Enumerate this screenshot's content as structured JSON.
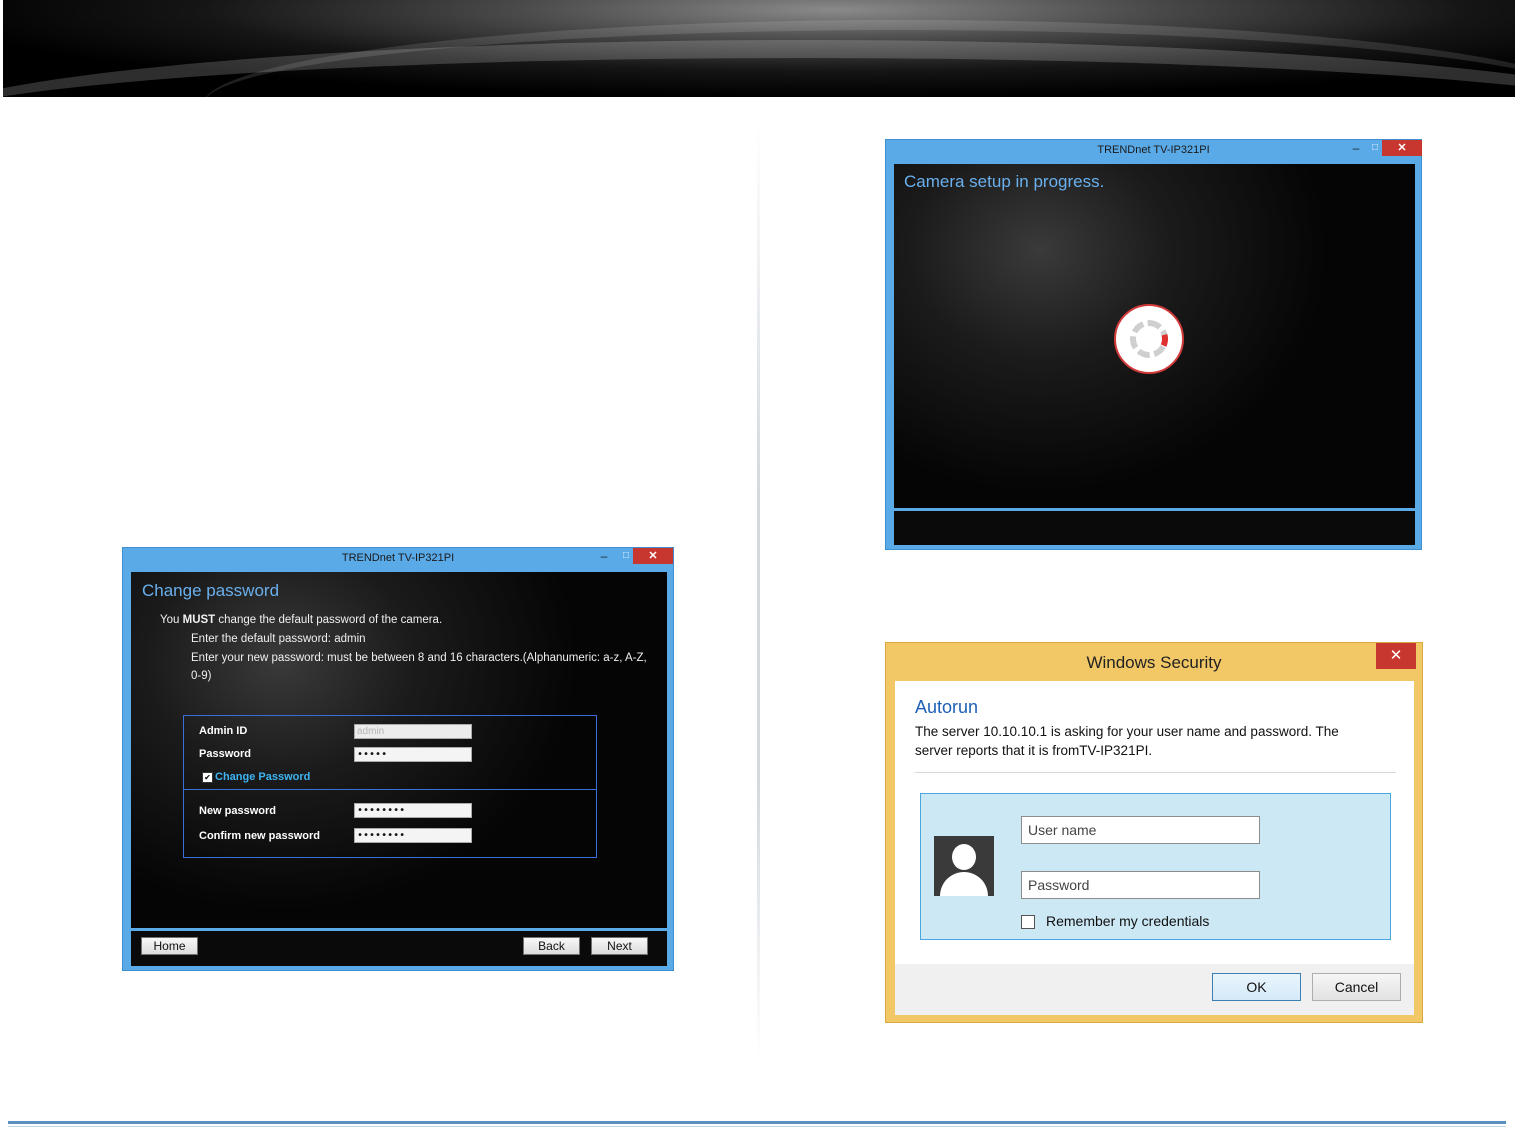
{
  "change_password_window": {
    "title": "TRENDnet TV-IP321PI",
    "min_glyph": "–",
    "max_glyph": "□",
    "close_glyph": "✕",
    "heading": "Change password",
    "must_prefix": "You ",
    "must_bold": "MUST",
    "must_suffix": " change the default password of the camera.",
    "line_default": "Enter the default password: admin",
    "line_new_1": "Enter your new password: must be between 8 and 16 characters.(Alphanumeric: a-z, A-Z,",
    "line_new_2": "0-9)",
    "admin_id_label": "Admin ID",
    "admin_id_value": "admin",
    "password_label": "Password",
    "password_value": "•••••",
    "change_password_checked_glyph": "✔",
    "change_password_label": "Change Password",
    "new_password_label": "New password",
    "new_password_value": "••••••••",
    "confirm_label": "Confirm new password",
    "confirm_value": "••••••••",
    "home_button": "Home",
    "back_button": "Back",
    "next_button": "Next"
  },
  "camera_setup_window": {
    "title": "TRENDnet TV-IP321PI",
    "min_glyph": "–",
    "max_glyph": "□",
    "close_glyph": "✕",
    "status_text": "Camera setup in progress."
  },
  "windows_security": {
    "title": "Windows Security",
    "close_glyph": "✕",
    "heading": "Autorun",
    "message": "The server 10.10.10.1 is asking for your user name and password. The server reports that it is fromTV-IP321PI.",
    "username_placeholder": "User name",
    "password_placeholder": "Password",
    "remember_label": "Remember my credentials",
    "ok_button": "OK",
    "cancel_button": "Cancel",
    "accent_color": "#f2c867"
  },
  "colors": {
    "trendnet_accent": "#5aaae8",
    "heading_blue": "#6ab0ee",
    "close_red": "#c7372f"
  }
}
